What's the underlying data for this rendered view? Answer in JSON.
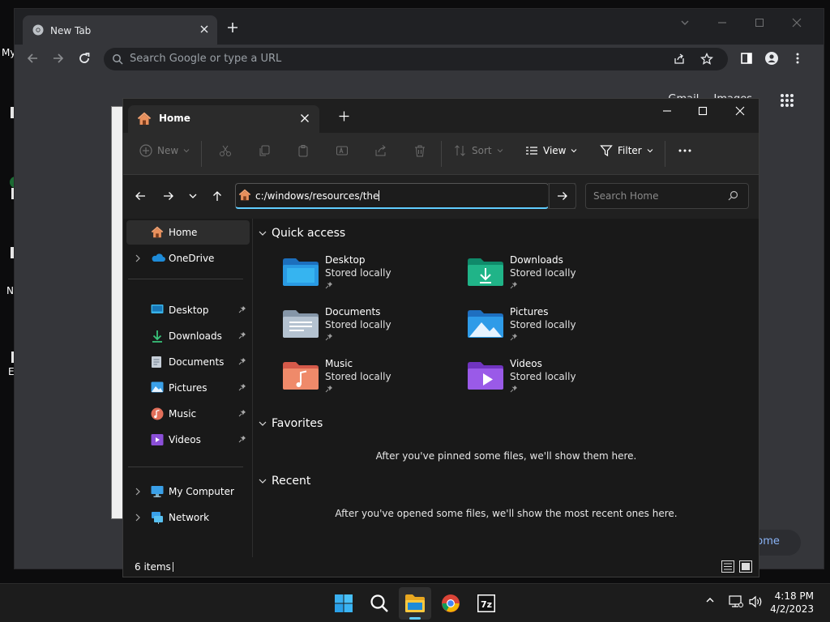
{
  "desktop": {
    "icon_fragments": [
      "My",
      "N",
      "E"
    ]
  },
  "chrome": {
    "tab_title": "New Tab",
    "omnibox_placeholder": "Search Google or type a URL",
    "links": [
      "Gmail",
      "Images"
    ],
    "customize_label": "hrome",
    "colors": {
      "frame": "#202124",
      "toolbar": "#35363a"
    }
  },
  "explorer": {
    "tab_title": "Home",
    "commands": {
      "new": "New",
      "sort": "Sort",
      "view": "View",
      "filter": "Filter"
    },
    "address_value": "c:/windows/resources/the",
    "search_placeholder": "Search Home",
    "nav": {
      "home": "Home",
      "onedrive": "OneDrive",
      "pinned": [
        "Desktop",
        "Downloads",
        "Documents",
        "Pictures",
        "Music",
        "Videos"
      ],
      "my_computer": "My Computer",
      "network": "Network"
    },
    "sections": {
      "quick_access": "Quick access",
      "favorites": "Favorites",
      "recent": "Recent"
    },
    "quick_access": [
      {
        "name": "Desktop",
        "status": "Stored locally",
        "icon": "desktop-folder-icon"
      },
      {
        "name": "Downloads",
        "status": "Stored locally",
        "icon": "downloads-folder-icon"
      },
      {
        "name": "Documents",
        "status": "Stored locally",
        "icon": "documents-folder-icon"
      },
      {
        "name": "Pictures",
        "status": "Stored locally",
        "icon": "pictures-folder-icon"
      },
      {
        "name": "Music",
        "status": "Stored locally",
        "icon": "music-folder-icon"
      },
      {
        "name": "Videos",
        "status": "Stored locally",
        "icon": "videos-folder-icon"
      }
    ],
    "favorites_empty": "After you've pinned some files, we'll show them here.",
    "recent_empty": "After you've opened some files, we'll show the most recent ones here.",
    "status_count": "6 items",
    "accent_color": "#60cdff"
  },
  "taskbar": {
    "apps": [
      "start-icon",
      "search-icon",
      "file-explorer-icon",
      "chrome-icon",
      "7zip-icon"
    ],
    "time": "4:18 PM",
    "date": "4/2/2023",
    "seven_zip_label": "7z"
  }
}
